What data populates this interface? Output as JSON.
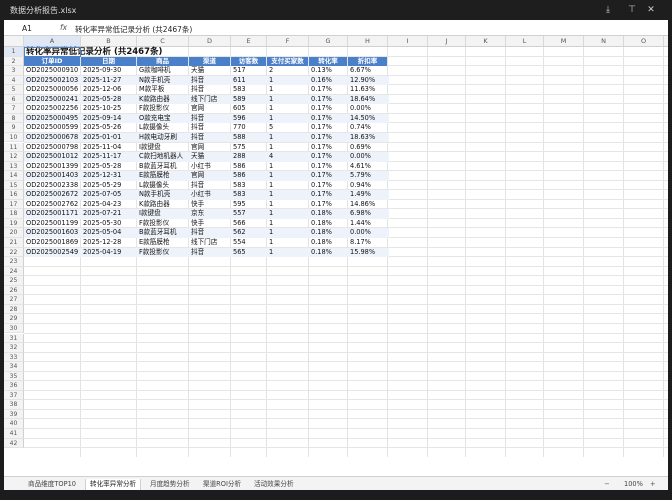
{
  "window": {
    "title": "数据分析报告.xlsx",
    "icons": [
      "download-icon",
      "pin-icon",
      "close-icon"
    ]
  },
  "formula_bar": {
    "cell_ref": "A1",
    "fx_label": "fx",
    "content": "转化率异常低记录分析 (共2467条)"
  },
  "columns": [
    "A",
    "B",
    "C",
    "D",
    "E",
    "F",
    "G",
    "H",
    "I",
    "J",
    "K",
    "L",
    "M",
    "N",
    "O",
    "P"
  ],
  "sheet_title": "转化率异常低记录分析 (共2467条)",
  "table": {
    "headers": [
      "订单ID",
      "日期",
      "商品",
      "渠道",
      "访客数",
      "支付买家数",
      "转化率",
      "折扣率"
    ],
    "rows": [
      [
        "OD2025000910",
        "2025-09-30",
        "G款咖啡机",
        "天猫",
        "517",
        "2",
        "0.13%",
        "6.67%"
      ],
      [
        "OD2025002103",
        "2025-11-27",
        "N款手机壳",
        "抖音",
        "611",
        "1",
        "0.16%",
        "12.90%"
      ],
      [
        "OD2025000056",
        "2025-12-06",
        "M款平板",
        "抖音",
        "583",
        "1",
        "0.17%",
        "11.63%"
      ],
      [
        "OD2025000241",
        "2025-05-28",
        "K款路由器",
        "线下门店",
        "589",
        "1",
        "0.17%",
        "18.64%"
      ],
      [
        "OD2025002256",
        "2025-10-25",
        "F款投影仪",
        "官网",
        "605",
        "1",
        "0.17%",
        "0.00%"
      ],
      [
        "OD2025000495",
        "2025-09-14",
        "O款充电宝",
        "抖音",
        "596",
        "1",
        "0.17%",
        "14.50%"
      ],
      [
        "OD2025000599",
        "2025-05-26",
        "L款摄像头",
        "抖音",
        "770",
        "5",
        "0.17%",
        "0.74%"
      ],
      [
        "OD2025000678",
        "2025-01-01",
        "H款电动牙刷",
        "抖音",
        "588",
        "1",
        "0.17%",
        "18.63%"
      ],
      [
        "OD2025000798",
        "2025-11-04",
        "I款键盘",
        "官网",
        "575",
        "1",
        "0.17%",
        "0.69%"
      ],
      [
        "OD2025001012",
        "2025-11-17",
        "C款扫地机器人",
        "天猫",
        "288",
        "4",
        "0.17%",
        "0.00%"
      ],
      [
        "OD2025001399",
        "2025-05-28",
        "B款蓝牙耳机",
        "小红书",
        "586",
        "1",
        "0.17%",
        "4.61%"
      ],
      [
        "OD2025001403",
        "2025-12-31",
        "E款筋膜枪",
        "官网",
        "586",
        "1",
        "0.17%",
        "5.79%"
      ],
      [
        "OD2025002338",
        "2025-05-29",
        "L款摄像头",
        "抖音",
        "583",
        "1",
        "0.17%",
        "0.94%"
      ],
      [
        "OD2025002672",
        "2025-07-05",
        "N款手机壳",
        "小红书",
        "583",
        "1",
        "0.17%",
        "1.49%"
      ],
      [
        "OD2025002762",
        "2025-04-23",
        "K款路由器",
        "快手",
        "595",
        "1",
        "0.17%",
        "14.86%"
      ],
      [
        "OD2025001171",
        "2025-07-21",
        "I款键盘",
        "京东",
        "557",
        "1",
        "0.18%",
        "6.98%"
      ],
      [
        "OD2025001199",
        "2025-05-30",
        "F款投影仪",
        "快手",
        "566",
        "1",
        "0.18%",
        "1.44%"
      ],
      [
        "OD2025001603",
        "2025-05-04",
        "B款蓝牙耳机",
        "抖音",
        "562",
        "1",
        "0.18%",
        "0.00%"
      ],
      [
        "OD2025001869",
        "2025-12-28",
        "E款筋膜枪",
        "线下门店",
        "554",
        "1",
        "0.18%",
        "8.17%"
      ],
      [
        "OD2025002549",
        "2025-04-19",
        "F款投影仪",
        "抖音",
        "565",
        "1",
        "0.18%",
        "15.98%"
      ]
    ]
  },
  "row_count": 42,
  "sheet_tabs": [
    "商品维度TOP10",
    "转化率异常分析",
    "月度趋势分析",
    "渠道ROI分析",
    "活动效果分析"
  ],
  "active_tab": "转化率异常分析",
  "zoom": {
    "minus": "−",
    "value": "100%",
    "plus": "+"
  },
  "colors": {
    "header_fill": "#4a7fc9",
    "band_fill": "#eef3fb",
    "selection": "#4a7fc9"
  }
}
